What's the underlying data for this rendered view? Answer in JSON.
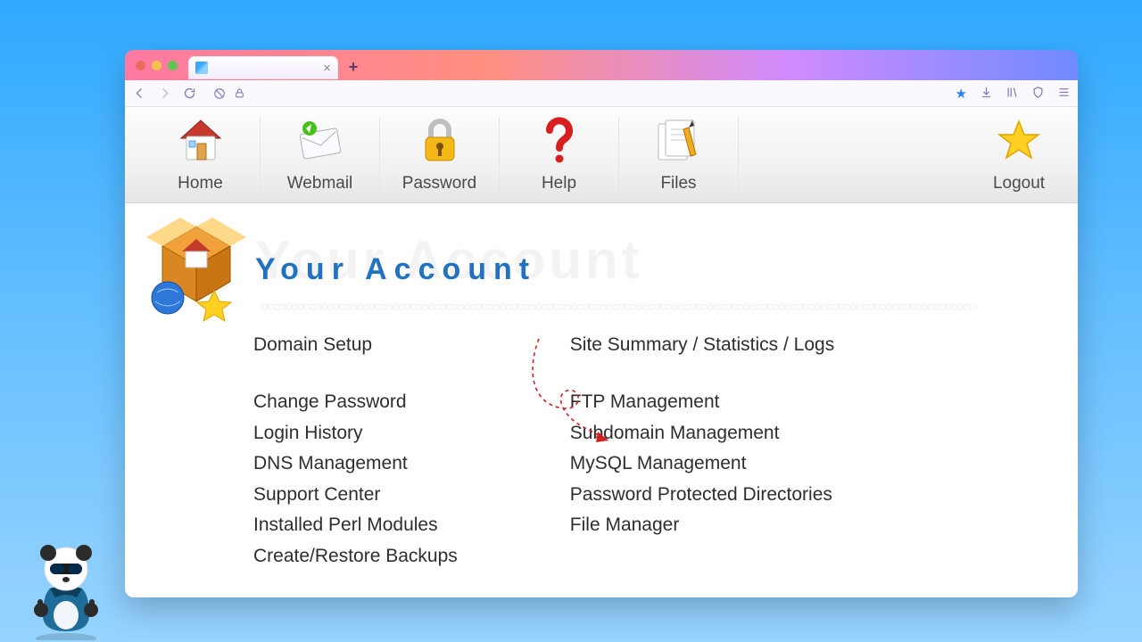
{
  "browser": {
    "tab_close_glyph": "×",
    "new_tab_glyph": "+"
  },
  "toolbar": {
    "home": "Home",
    "webmail": "Webmail",
    "password": "Password",
    "help": "Help",
    "files": "Files",
    "logout": "Logout"
  },
  "account": {
    "title_ghost": "Your Account",
    "title": "Your Account"
  },
  "links_left": {
    "domain_setup": "Domain Setup",
    "change_password": "Change Password",
    "login_history": "Login History",
    "dns_management": "DNS Management",
    "support_center": "Support Center",
    "installed_perl": "Installed Perl Modules",
    "create_restore": "Create/Restore Backups"
  },
  "links_right": {
    "site_summary": "Site Summary / Statistics / Logs",
    "ftp_management": "FTP Management",
    "subdomain_mgmt": "Subdomain Management",
    "mysql_mgmt": "MySQL Management",
    "pw_protected_dirs": "Password Protected Directories",
    "file_manager": "File Manager"
  }
}
